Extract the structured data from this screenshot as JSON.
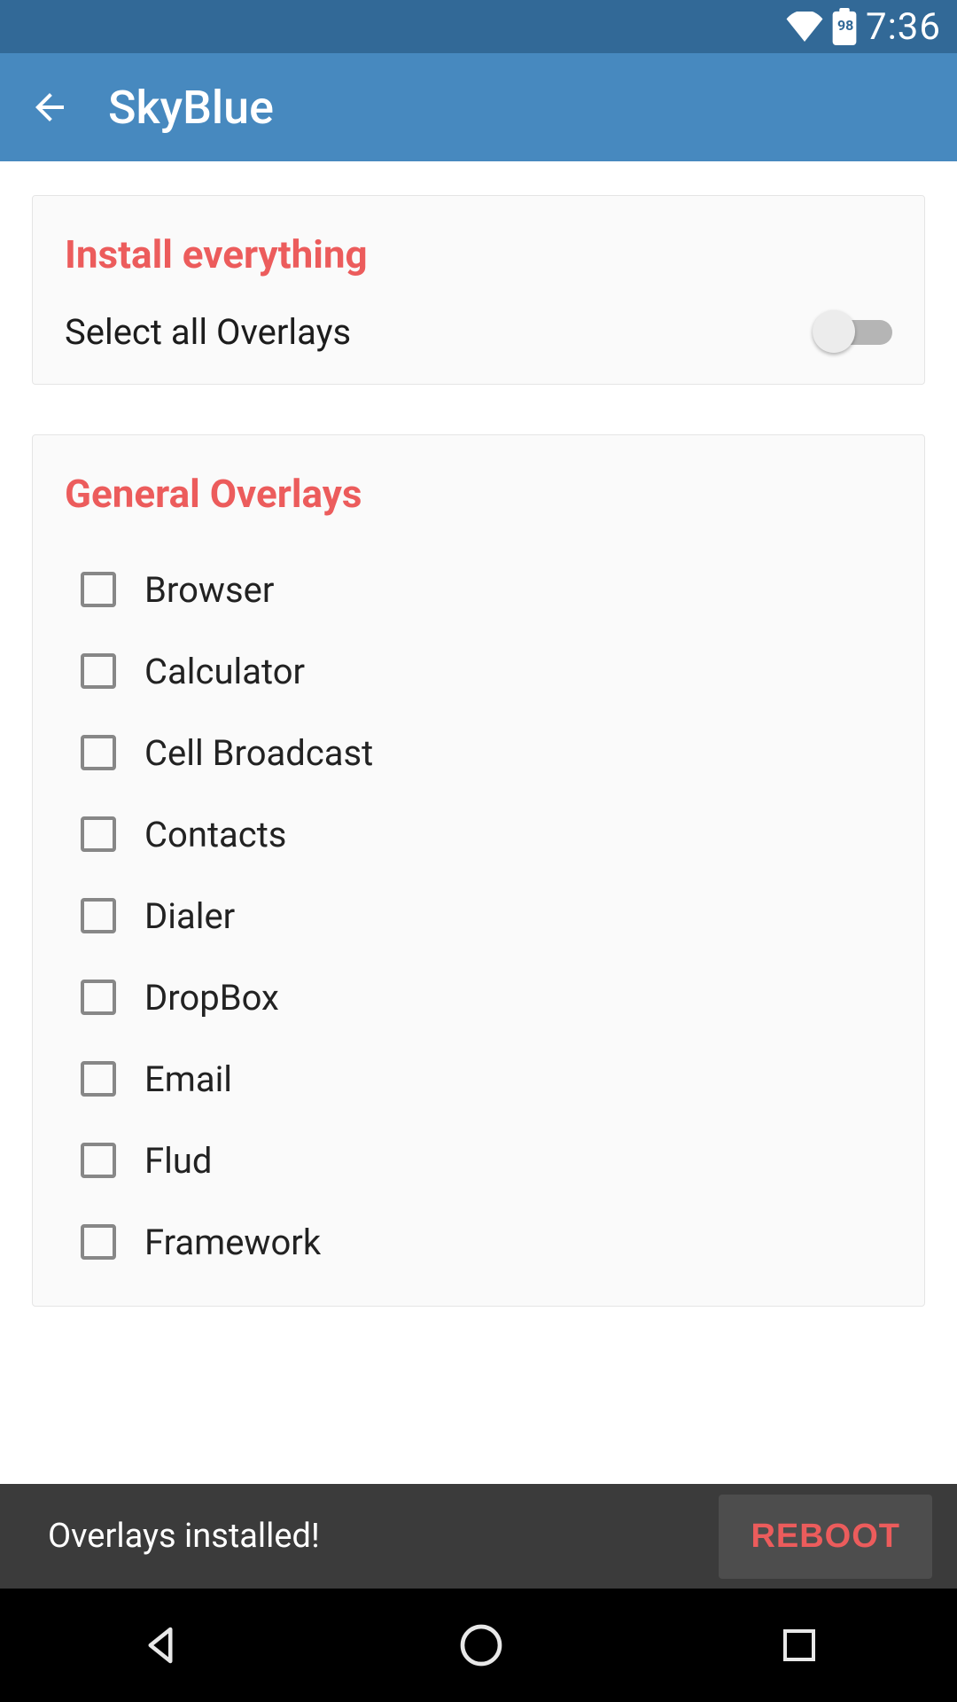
{
  "status": {
    "battery_level": "98",
    "time": "7:36"
  },
  "appbar": {
    "title": "SkyBlue"
  },
  "install_card": {
    "title": "Install everything",
    "select_all_label": "Select all Overlays",
    "select_all_on": false
  },
  "overlays_card": {
    "title": "General Overlays",
    "items": [
      {
        "label": "Browser",
        "checked": false
      },
      {
        "label": "Calculator",
        "checked": false
      },
      {
        "label": "Cell Broadcast",
        "checked": false
      },
      {
        "label": "Contacts",
        "checked": false
      },
      {
        "label": "Dialer",
        "checked": false
      },
      {
        "label": "DropBox",
        "checked": false
      },
      {
        "label": "Email",
        "checked": false
      },
      {
        "label": "Flud",
        "checked": false
      },
      {
        "label": "Framework",
        "checked": false
      }
    ]
  },
  "snackbar": {
    "message": "Overlays installed!",
    "action": "REBOOT"
  },
  "colors": {
    "status_bg": "#326997",
    "appbar_bg": "#4789bf",
    "accent": "#ec5c5c",
    "card_bg": "#fafafa"
  }
}
